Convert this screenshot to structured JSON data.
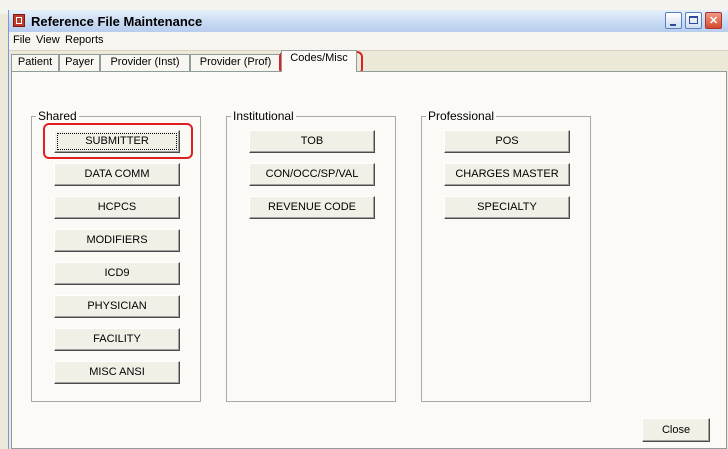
{
  "window": {
    "title": "Reference File Maintenance"
  },
  "menu": [
    "File",
    "View",
    "Reports"
  ],
  "tabs": [
    "Patient",
    "Payer",
    "Provider (Inst)",
    "Provider (Prof)",
    "Codes/Misc"
  ],
  "groups": {
    "shared": {
      "legend": "Shared",
      "buttons": [
        "SUBMITTER",
        "DATA COMM",
        "HCPCS",
        "MODIFIERS",
        "ICD9",
        "PHYSICIAN",
        "FACILITY",
        "MISC ANSI"
      ]
    },
    "institutional": {
      "legend": "Institutional",
      "buttons": [
        "TOB",
        "CON/OCC/SP/VAL",
        "REVENUE CODE"
      ]
    },
    "professional": {
      "legend": "Professional",
      "buttons": [
        "POS",
        "CHARGES MASTER",
        "SPECIALTY"
      ]
    }
  },
  "footer": {
    "close_label": "Close"
  },
  "colors": {
    "highlight": "#e02020",
    "panel": "#fbfaf6",
    "window": "#ece9d8"
  }
}
